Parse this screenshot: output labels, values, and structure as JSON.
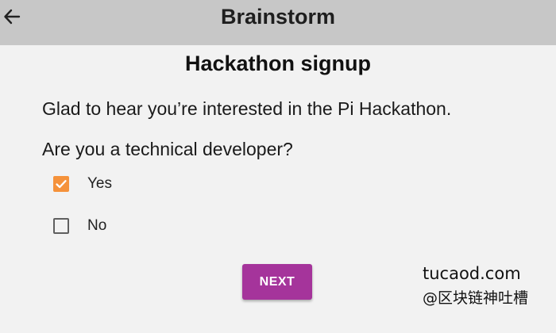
{
  "header": {
    "title": "Brainstorm",
    "back_icon": "arrow-left-icon"
  },
  "form": {
    "title": "Hackathon signup",
    "intro": "Glad to hear you’re interested in the Pi Hackathon.",
    "question": "Are you a technical developer?",
    "options": [
      {
        "label": "Yes",
        "checked": true
      },
      {
        "label": "No",
        "checked": false
      }
    ],
    "next_label": "NEXT"
  },
  "watermark": {
    "site": "tucaod.com",
    "handle": "@区块链神吐槽"
  },
  "colors": {
    "appbar": "#c7c7c7",
    "background": "#f2f2f2",
    "checkbox_checked": "#f5923b",
    "next_button": "#a5349b"
  }
}
